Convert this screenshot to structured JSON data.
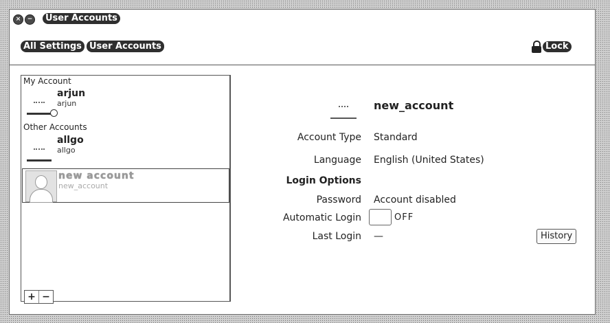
{
  "window": {
    "title": "User Accounts",
    "close_glyph": "×",
    "minimize_glyph": "−"
  },
  "toolbar": {
    "breadcrumbs": [
      "All Settings",
      "User Accounts"
    ],
    "lock_label": "Lock",
    "lock_icon": "lock-icon"
  },
  "sidebar": {
    "my_account_header": "My Account",
    "other_accounts_header": "Other Accounts",
    "accounts": [
      {
        "name": "arjun",
        "username": "arjun",
        "section": "My Account"
      },
      {
        "name": "allgo",
        "username": "allgo",
        "section": "Other Accounts"
      },
      {
        "name": "new account",
        "username": "new_account",
        "section": "Other Accounts",
        "selected": true
      }
    ],
    "add_label": "+",
    "remove_label": "−"
  },
  "detail": {
    "account_title": "new_account",
    "fields": {
      "account_type": {
        "label": "Account Type",
        "value": "Standard"
      },
      "language": {
        "label": "Language",
        "value": "English (United States)"
      },
      "login_options": {
        "label": "Login Options"
      },
      "password": {
        "label": "Password",
        "value": "Account disabled"
      },
      "automatic_login": {
        "label": "Automatic Login",
        "state": "OFF"
      },
      "last_login": {
        "label": "Last Login",
        "value": "—"
      }
    },
    "history_label": "History"
  }
}
